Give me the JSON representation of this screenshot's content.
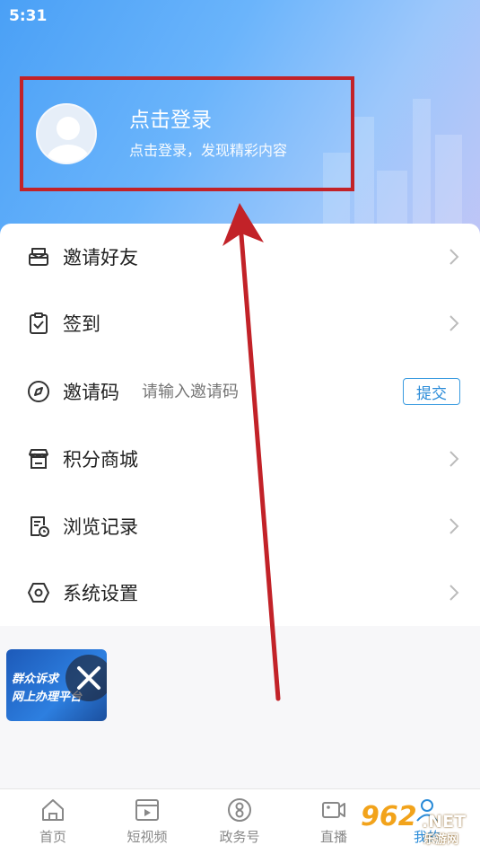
{
  "status_bar": {
    "time": "5:31"
  },
  "profile": {
    "title": "点击登录",
    "subtitle": "点击登录，发现精彩内容"
  },
  "menu": {
    "items": [
      {
        "label": "邀请好友",
        "icon": "mail-icon"
      },
      {
        "label": "签到",
        "icon": "clipboard-check-icon"
      },
      {
        "label": "邀请码",
        "icon": "compass-icon",
        "input_placeholder": "请输入邀请码",
        "button_label": "提交"
      },
      {
        "label": "积分商城",
        "icon": "store-icon"
      },
      {
        "label": "浏览记录",
        "icon": "history-icon"
      },
      {
        "label": "系统设置",
        "icon": "hexagon-settings-icon"
      }
    ]
  },
  "banner": {
    "line1": "群众诉求",
    "line2": "网上办理平台"
  },
  "tabbar": {
    "tabs": [
      {
        "label": "首页",
        "icon": "home-icon"
      },
      {
        "label": "短视频",
        "icon": "video-clip-icon"
      },
      {
        "label": "政务号",
        "icon": "badge-icon"
      },
      {
        "label": "直播",
        "icon": "camera-icon"
      },
      {
        "label": "我的",
        "icon": "user-icon"
      }
    ]
  },
  "watermark": {
    "big": "962",
    "net": ".NET",
    "cn": "乐游网"
  },
  "colors": {
    "accent": "#2a8bd8",
    "annotation_red": "#c22228",
    "header_blue": "#4aa0f6"
  }
}
